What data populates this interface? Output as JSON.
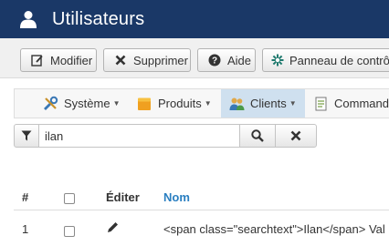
{
  "header": {
    "title": "Utilisateurs",
    "icon": "user-icon",
    "background": "#1a3867"
  },
  "toolbar": {
    "buttons": [
      {
        "label": "Modifier",
        "icon": "edit-icon"
      },
      {
        "label": "Supprimer",
        "icon": "close-icon"
      },
      {
        "label": "Aide",
        "icon": "help-icon"
      },
      {
        "label": "Panneau de contrôle",
        "icon": "gear-icon"
      }
    ]
  },
  "menu": {
    "items": [
      {
        "label": "Système",
        "icon": "tools-icon"
      },
      {
        "label": "Produits",
        "icon": "box-icon"
      },
      {
        "label": "Clients",
        "icon": "users-icon"
      },
      {
        "label": "Command",
        "icon": "orders-icon"
      }
    ]
  },
  "search": {
    "value": "ilan",
    "placeholder": ""
  },
  "table": {
    "headers": {
      "num": "#",
      "edit": "Éditer",
      "name": "Nom"
    },
    "rows": [
      {
        "num": "1",
        "name": "<span class=\"searchtext\">Ilan</span> Val"
      }
    ]
  }
}
